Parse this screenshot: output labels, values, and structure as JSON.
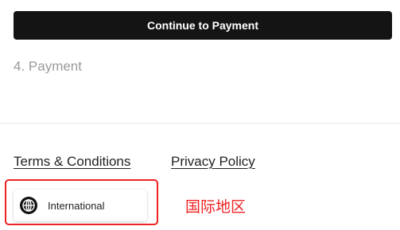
{
  "checkout": {
    "continue_label": "Continue to Payment",
    "payment_step_label": "4. Payment"
  },
  "footer": {
    "terms_label": "Terms & Conditions",
    "privacy_label": "Privacy Policy",
    "region_label": "International",
    "region_icon": "globe-icon"
  },
  "annotation": {
    "text": "国际地区",
    "color": "#ee2222"
  },
  "colors": {
    "button_bg": "#141414",
    "muted_text": "#9a9a9a",
    "highlight": "#ee2222"
  }
}
